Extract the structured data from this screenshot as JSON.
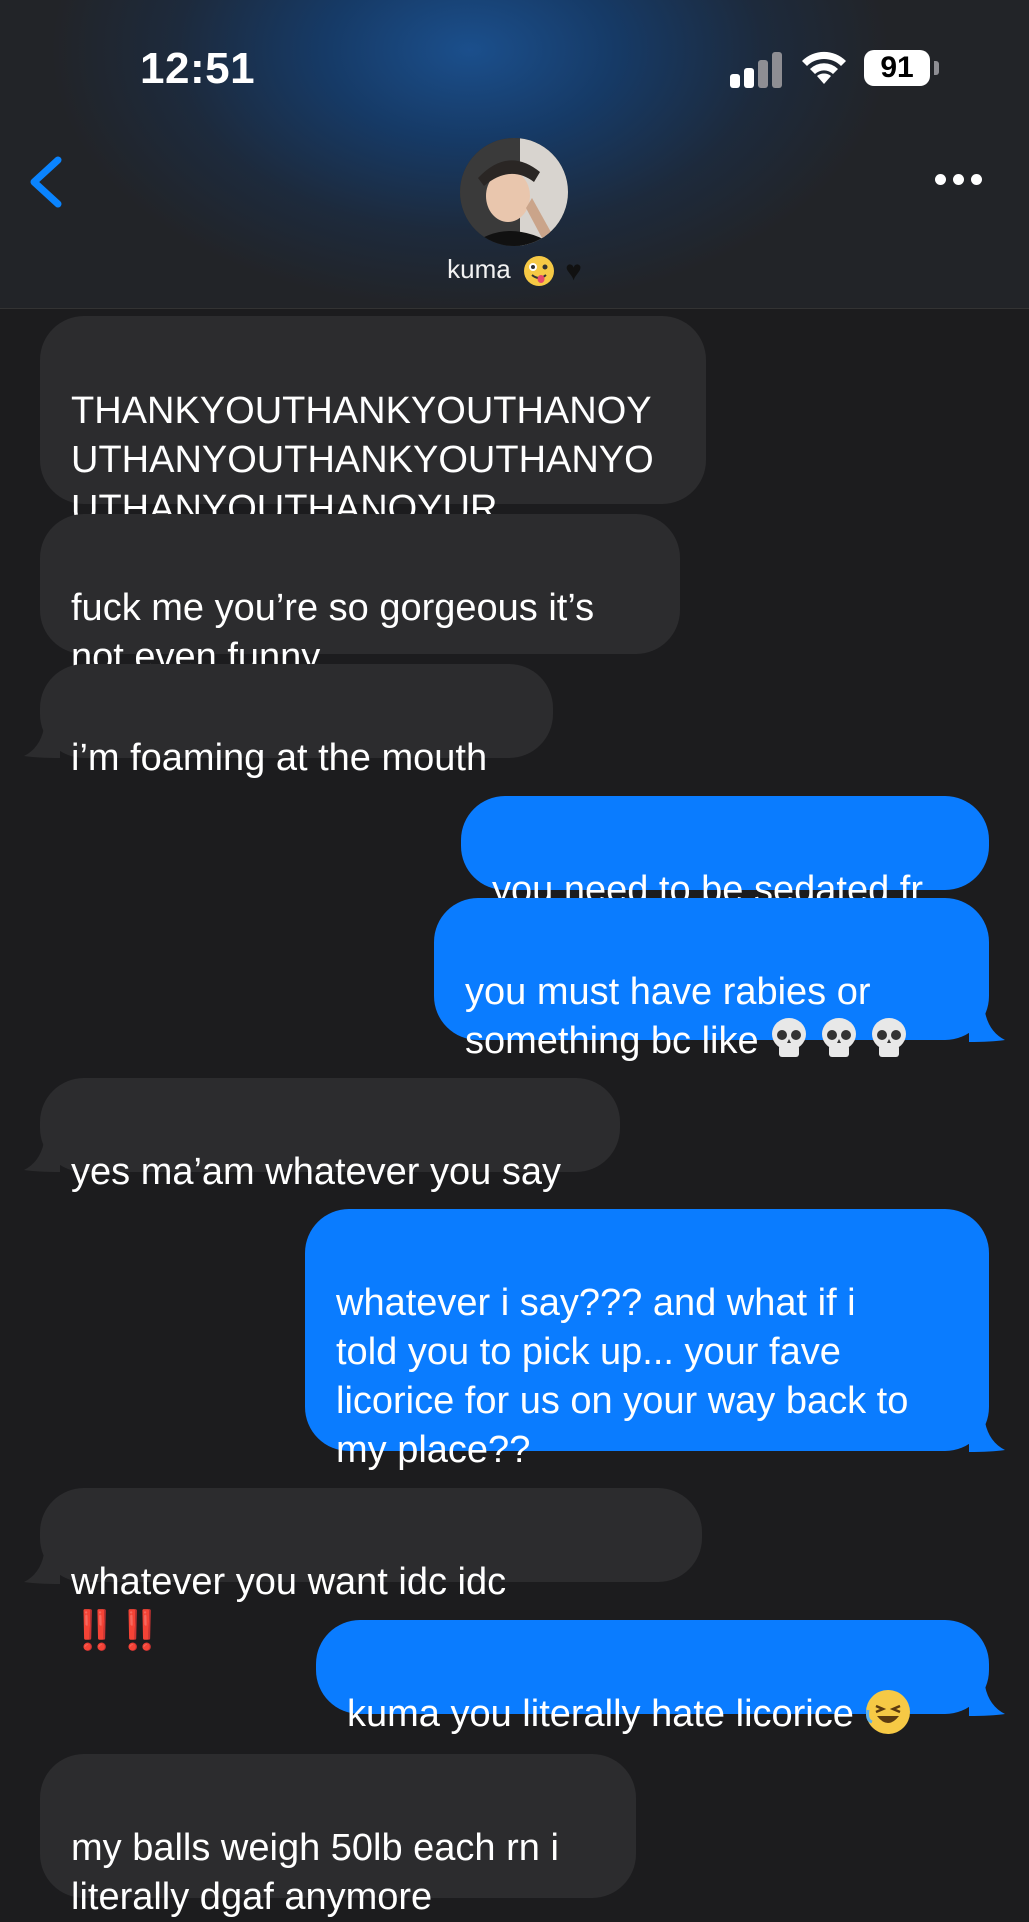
{
  "status_bar": {
    "time": "12:51",
    "battery": "91"
  },
  "header": {
    "contact_name": "kuma"
  },
  "messages": [
    {
      "dir": "in",
      "text": "THANKYOUTHANKYOUTHANOY\nUTHANYOUTHANKYOUTHANYO\nUTHANYOUTHANOYUR"
    },
    {
      "dir": "in",
      "text": "fuck me you’re so gorgeous it’s\nnot even funny"
    },
    {
      "dir": "in",
      "text": "i’m foaming at the mouth"
    },
    {
      "dir": "out",
      "text": "you need to be sedated fr"
    },
    {
      "dir": "out",
      "text": "you must have rabies or\nsomething bc like"
    },
    {
      "dir": "in",
      "text": "yes ma’am whatever you say"
    },
    {
      "dir": "out",
      "text": "whatever i say??? and what if i\ntold you to pick up... your fave\nlicorice for us on your way back to\nmy place??"
    },
    {
      "dir": "in",
      "text": "whatever you want idc idc",
      "suffix": "‼️‼️"
    },
    {
      "dir": "out",
      "text": "kuma you literally hate licorice"
    },
    {
      "dir": "in",
      "text": "my balls weigh 50lb each rn i\nliterally dgaf anymore"
    }
  ],
  "icons": [
    "back-chevron-icon",
    "more-icon",
    "signal-icon",
    "wifi-icon",
    "battery-icon",
    "skull-emoji-icon",
    "laughing-emoji-icon",
    "zany-face-emoji-icon",
    "black-heart-emoji-icon"
  ],
  "colors": {
    "incoming_bubble": "#2c2c2e",
    "outgoing_bubble": "#0a7cff",
    "accent": "#0a84ff",
    "background": "#1c1c1e"
  }
}
